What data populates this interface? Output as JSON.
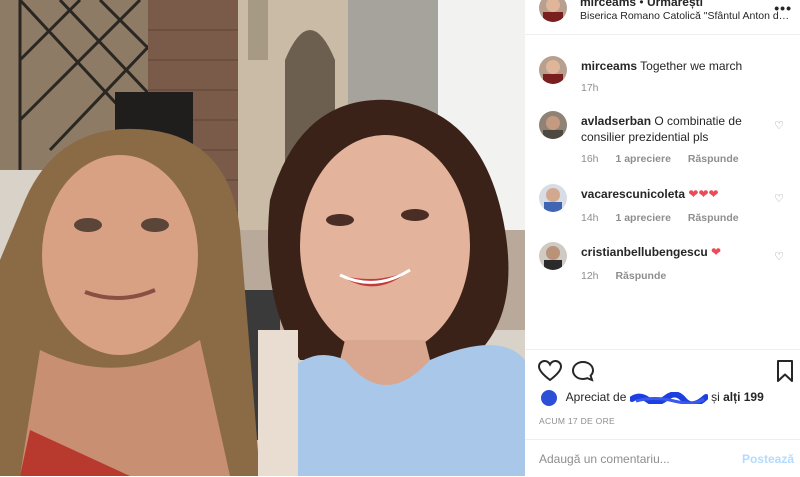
{
  "post": {
    "username": "mirceams",
    "separator": "•",
    "follow_label": "Urmărești",
    "location": "Biserica Romano Catolică \"Sfântul Anton de P...",
    "more_label": "•••"
  },
  "caption": {
    "username": "mirceams",
    "text": "Together we march",
    "time": "17h"
  },
  "comments": [
    {
      "username": "avladserban",
      "text": "O combinatie de consilier prezidential pls",
      "time": "16h",
      "likes": "1 apreciere",
      "reply": "Răspunde"
    },
    {
      "username": "vacarescunicoleta",
      "text": "❤❤❤",
      "time": "14h",
      "likes": "1 apreciere",
      "reply": "Răspunde"
    },
    {
      "username": "cristianbellubengescu",
      "text": "❤",
      "time": "12h",
      "likes": "",
      "reply": "Răspunde"
    }
  ],
  "likes_line": {
    "prefix": "Apreciat de",
    "suffix": "și",
    "others": "alți 199"
  },
  "timestamp": "ACUM 17 DE ORE",
  "add_comment": {
    "placeholder": "Adaugă un comentariu...",
    "post_label": "Postează"
  },
  "colors": {
    "heart": "#ed4956",
    "link_disabled": "#b3dbff",
    "scribble": "#1d3fe0"
  },
  "icons": [
    "heart-icon",
    "comment-icon",
    "bookmark-icon",
    "more-icon"
  ]
}
